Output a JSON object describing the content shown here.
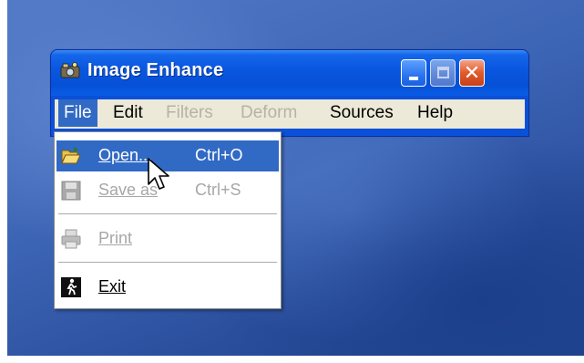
{
  "window": {
    "title": "Image Enhance",
    "title_color": "#ffffff",
    "titlebar_color": "#0a58e0",
    "close_glyph": "✕"
  },
  "menubar": {
    "items": [
      {
        "label": "File",
        "state": "active"
      },
      {
        "label": "Edit",
        "state": "enabled"
      },
      {
        "label": "Filters",
        "state": "disabled"
      },
      {
        "label": "Deform",
        "state": "disabled"
      },
      {
        "label": "Sources",
        "state": "enabled"
      },
      {
        "label": "Help",
        "state": "enabled"
      }
    ]
  },
  "file_menu": {
    "items": [
      {
        "label": "Open...",
        "mnemonic": "O",
        "accelerator": "Ctrl+O",
        "icon": "open-folder-icon",
        "state": "highlighted"
      },
      {
        "label": "Save as",
        "mnemonic": "S",
        "accelerator": "Ctrl+S",
        "icon": "floppy-disk-icon",
        "state": "disabled"
      },
      {
        "label": "Print",
        "mnemonic": "P",
        "accelerator": "",
        "icon": "printer-icon",
        "state": "disabled"
      },
      {
        "label": "Exit",
        "mnemonic": "E",
        "accelerator": "",
        "icon": "exit-door-icon",
        "state": "enabled"
      }
    ]
  },
  "colors": {
    "highlight": "#316ac5",
    "menu_bg": "#ece9d8",
    "disabled_text": "#a7a7a7",
    "desktop_blue": "#3c64b4"
  }
}
